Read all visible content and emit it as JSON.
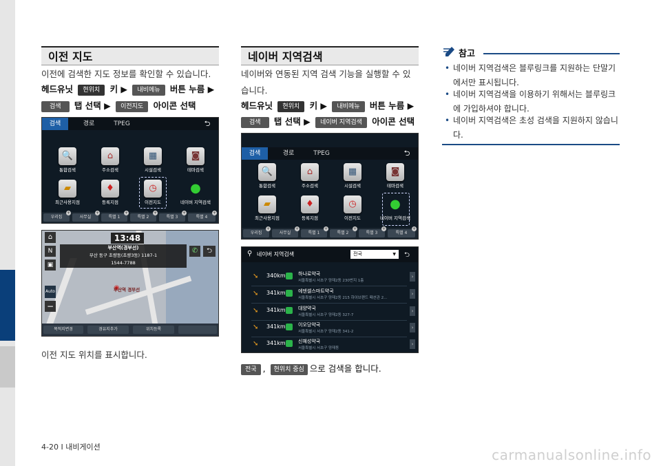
{
  "left": {
    "title": "이전 지도",
    "description": "이전에 검색한 지도 정보를 확인할 수 있습니다.",
    "step1": {
      "prefix": "헤드유닛",
      "chip1": "현위치",
      "key": "키 ▶",
      "chip2": "내비메뉴",
      "suffix": "버튼 누름 ▶"
    },
    "step2": {
      "chip1": "검색",
      "mid": "탭 선택 ▶",
      "chip2": "이전지도",
      "suffix": "아이콘 선택"
    },
    "caption": "이전 지도 위치를 표시합니다."
  },
  "middle": {
    "title": "네이버 지역검색",
    "description_line1": "네이버와 연동된 지역 검색 기능을 실행할 수 있",
    "description_line2": "습니다.",
    "step1": {
      "prefix": "헤드유닛",
      "chip1": "현위치",
      "key": "키 ▶",
      "chip2": "내비메뉴",
      "suffix": "버튼 누름 ▶"
    },
    "step2": {
      "chip1": "검색",
      "mid": "탭 선택 ▶",
      "chip2": "네이버 지역검색",
      "suffix": "아이콘 선택"
    },
    "bottom": {
      "chip1": "전국",
      "sep": ",",
      "chip2": "현위치 중심",
      "suffix": "으로 검색을 합니다."
    }
  },
  "search_menu": {
    "tabs": [
      "검색",
      "경로",
      "TPEG"
    ],
    "icons": [
      {
        "label": "통합검색",
        "icon": "search-icon"
      },
      {
        "label": "주소검색",
        "icon": "house-icon"
      },
      {
        "label": "시설검색",
        "icon": "building-icon"
      },
      {
        "label": "테마검색",
        "icon": "camera-icon"
      },
      {
        "label": "최근사용지점",
        "icon": "folder-icon"
      },
      {
        "label": "등록지점",
        "icon": "pin-icon"
      },
      {
        "label": "이전지도",
        "icon": "history-icon"
      },
      {
        "label": "네이버 지역검색",
        "icon": "naver-pin-icon"
      }
    ],
    "bottom_buttons": [
      "우리집",
      "사무실",
      "특별 1",
      "특별 2",
      "특별 3",
      "특별 4"
    ]
  },
  "map_screen": {
    "time": "13:48",
    "place_name": "부산역(경부선)",
    "address": "부산 동구 초량동(초량3동) 1187-1",
    "phone": "1544-7788",
    "map_label": "부산역 경부선",
    "auto": "Auto",
    "bottom_buttons": [
      "목적지변경",
      "경유지추가",
      "위치등록"
    ]
  },
  "naver_screen": {
    "title": "네이버 지역검색",
    "region": "전국",
    "results": [
      {
        "dist": "340km",
        "name": "하나로약국",
        "addr": "서울특별시 서초구 양재2동 230번지 1층"
      },
      {
        "dist": "341km",
        "name": "에덴셀스마트약국",
        "addr": "서울특별시 서초구 양재2동 215 하이브랜드 패션관 2..."
      },
      {
        "dist": "341km",
        "name": "대양약국",
        "addr": "서울특별시 서초구 양재2동 327-7"
      },
      {
        "dist": "341km",
        "name": "이오당약국",
        "addr": "서울특별시 서초구 양재2동 341-2"
      },
      {
        "dist": "341km",
        "name": "신혜성약국",
        "addr": "서울특별시 서초구 양재동"
      }
    ]
  },
  "note": {
    "title": "참고",
    "items": [
      "네이버 지역검색은 블루링크를 지원하는 단말기에서만 표시됩니다.",
      "네이버 지역검색을 이용하기 위해서는 블루링크에 가입하셔야 합니다.",
      "네이버 지역검색은 초성 검색을 지원하지 않습니다."
    ]
  },
  "footer": {
    "page": "4-20 I 내비게이션"
  },
  "watermark": "carmanualsonline.info"
}
